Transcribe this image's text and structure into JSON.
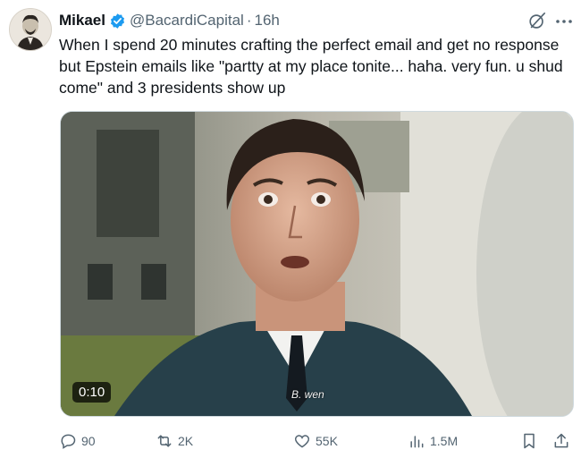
{
  "user": {
    "display_name": "Mikael",
    "handle": "@BacardiCapital",
    "separator": "·",
    "time": "16h"
  },
  "tweet": {
    "text": "When I spend 20 minutes crafting the perfect email and get no response but Epstein emails like \"partty at my place tonite... haha. very fun. u shud come\" and 3 presidents show up"
  },
  "media": {
    "duration": "0:10",
    "caption": "B. wen"
  },
  "actions": {
    "replies": "90",
    "reposts": "2K",
    "likes": "55K",
    "views": "1.5M"
  },
  "colors": {
    "text": "#0f1419",
    "secondary": "#536471",
    "verified": "#1d9bf0"
  },
  "icons": [
    "verified-badge-icon",
    "grok-icon",
    "more-icon",
    "reply-icon",
    "retweet-icon",
    "like-icon",
    "views-icon",
    "bookmark-icon",
    "share-icon"
  ]
}
